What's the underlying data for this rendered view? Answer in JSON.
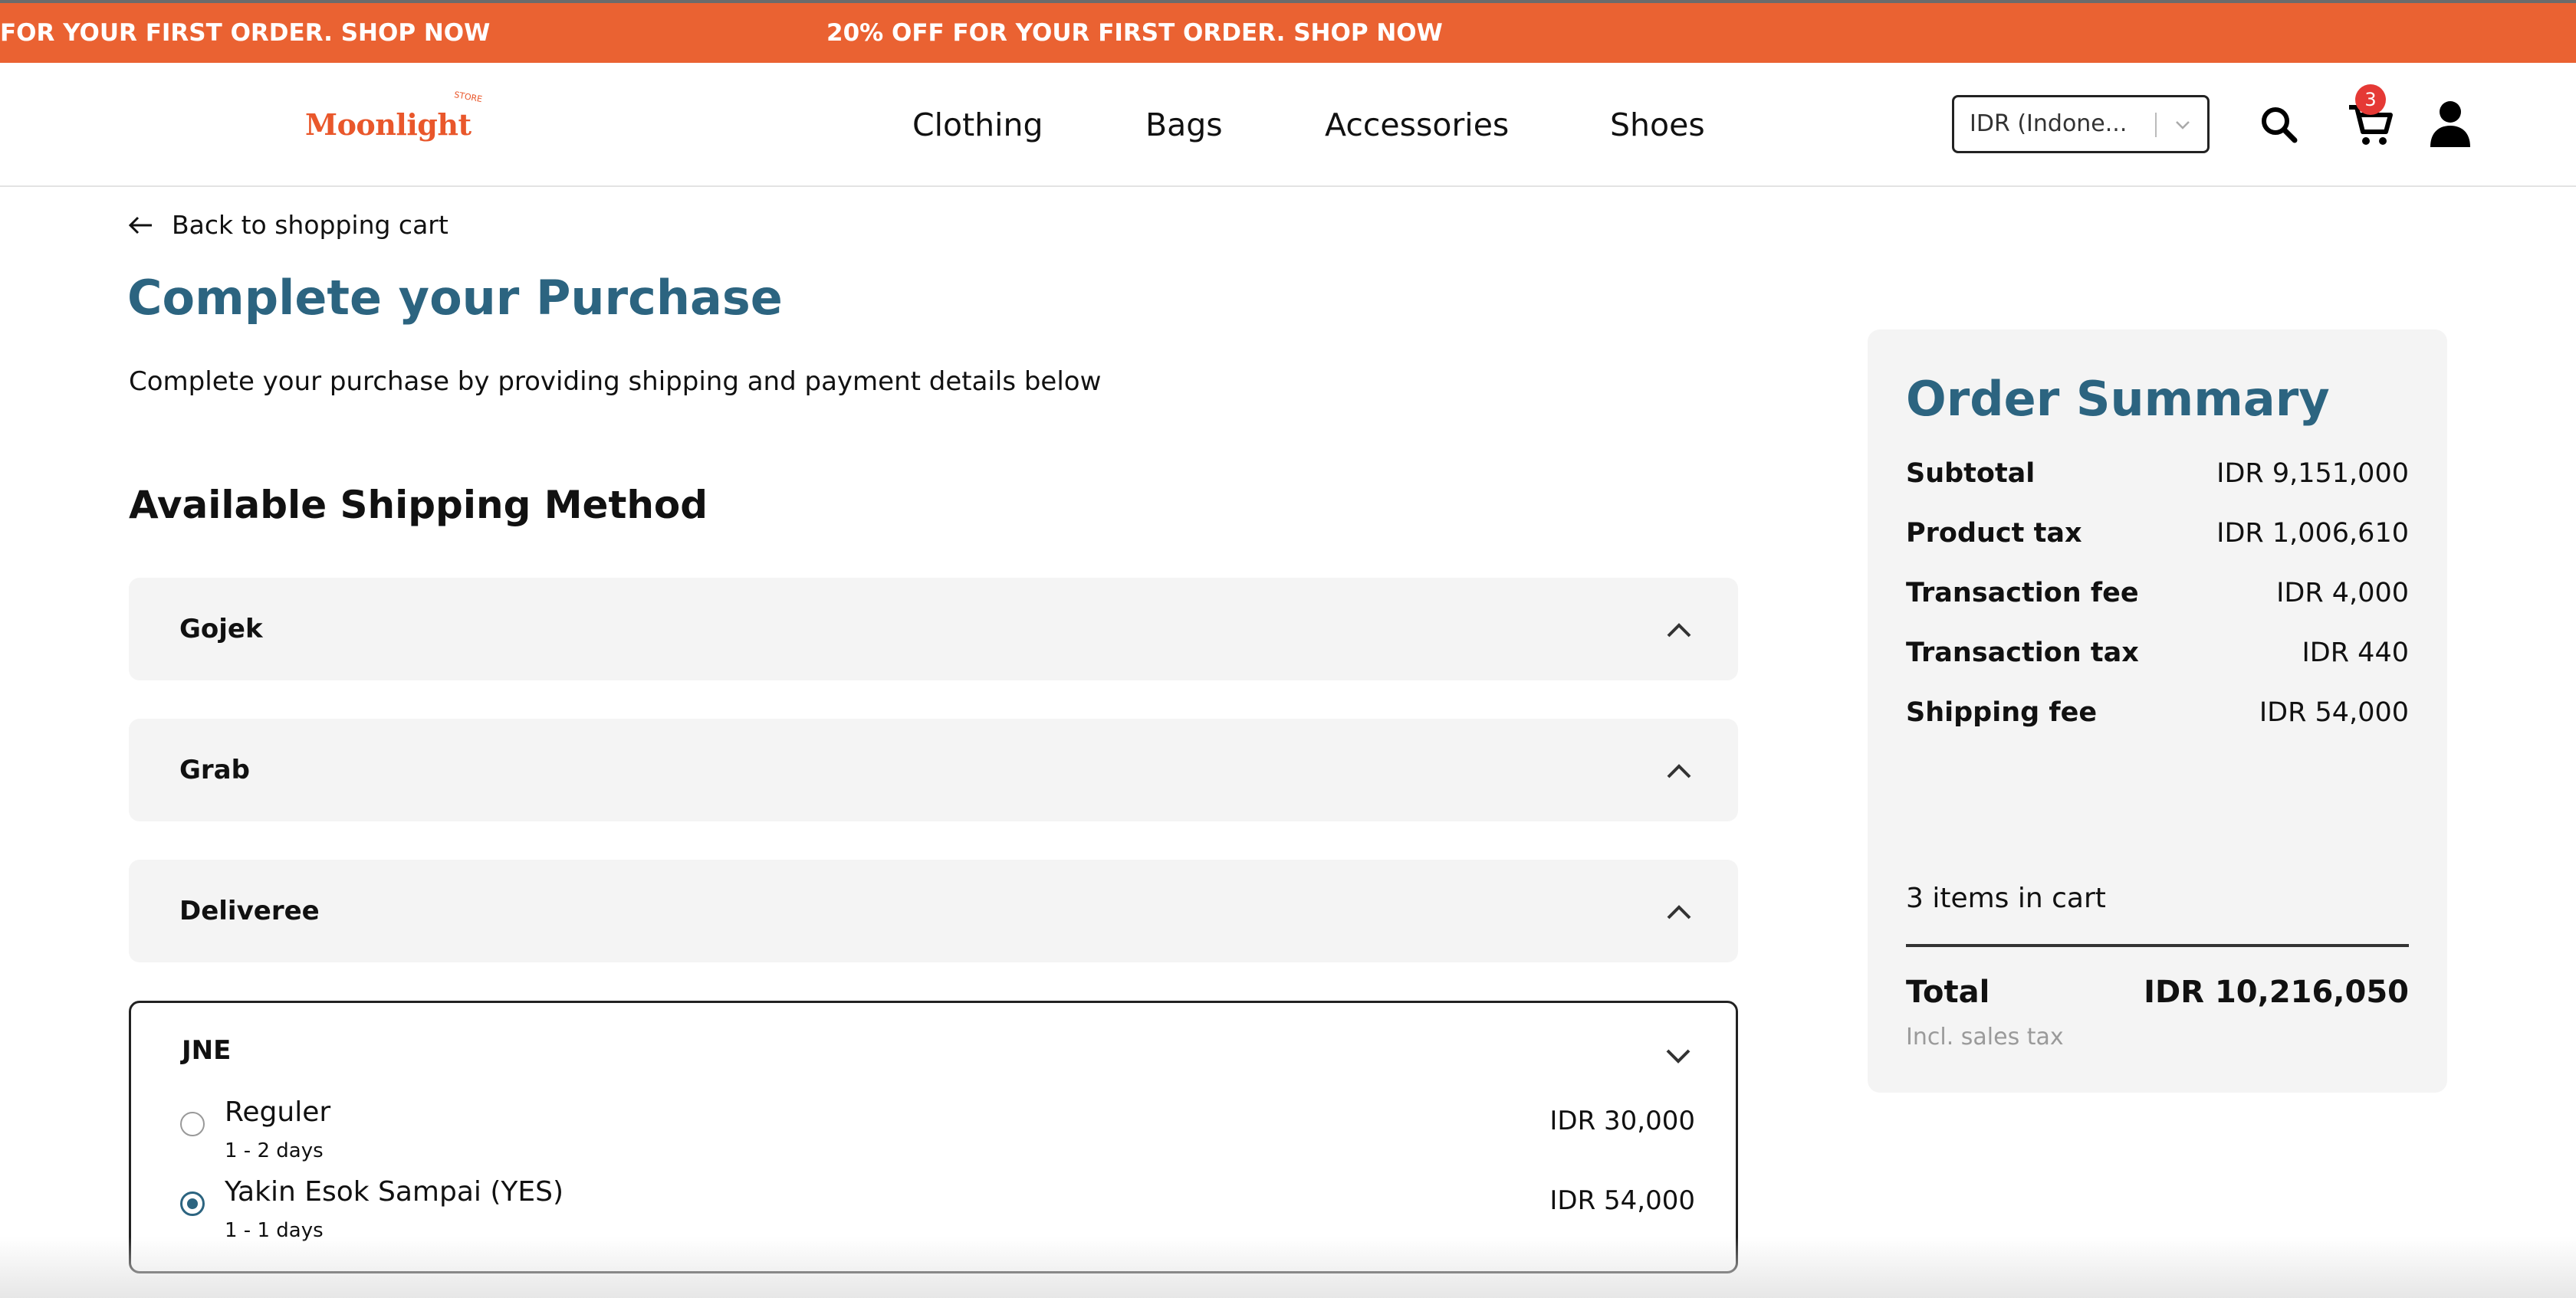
{
  "announcement": {
    "left_text": "FOR YOUR FIRST ORDER. SHOP NOW",
    "center_text": "20% OFF FOR YOUR FIRST ORDER. SHOP NOW",
    "background_color": "#ea6232"
  },
  "header": {
    "logo_text": "Moonlight",
    "logo_sub": "STORE",
    "nav": [
      "Clothing",
      "Bags",
      "Accessories",
      "Shoes"
    ],
    "currency_value": "IDR (Indone...",
    "cart_count": "3",
    "icons": [
      "search-icon",
      "cart-icon",
      "user-icon",
      "chevron-down-icon"
    ]
  },
  "back_link": "Back to shopping cart",
  "page_title": "Complete your Purchase",
  "subtitle": "Complete your purchase by providing shipping and payment details below",
  "shipping": {
    "section_title": "Available Shipping Method",
    "methods": [
      {
        "name": "Gojek",
        "expanded": false
      },
      {
        "name": "Grab",
        "expanded": false
      },
      {
        "name": "Deliveree",
        "expanded": false
      },
      {
        "name": "JNE",
        "expanded": true
      }
    ],
    "jne_options": [
      {
        "name": "Reguler",
        "days": "1 - 2 days",
        "price": "IDR 30,000",
        "selected": false
      },
      {
        "name": "Yakin Esok Sampai (YES)",
        "days": "1 - 1 days",
        "price": "IDR 54,000",
        "selected": true
      }
    ]
  },
  "summary": {
    "title": "Order Summary",
    "rows": [
      {
        "label": "Subtotal",
        "value": "IDR 9,151,000"
      },
      {
        "label": "Product tax",
        "value": "IDR 1,006,610"
      },
      {
        "label": "Transaction fee",
        "value": "IDR 4,000"
      },
      {
        "label": "Transaction tax",
        "value": "IDR 440"
      },
      {
        "label": "Shipping fee",
        "value": "IDR 54,000"
      }
    ],
    "items_in_cart": "3 items in cart",
    "total_label": "Total",
    "total_value": "IDR 10,216,050",
    "total_note": "Incl. sales tax"
  },
  "colors": {
    "accent": "#2c6480",
    "brand": "#e9572b",
    "panel": "#f4f4f4"
  }
}
